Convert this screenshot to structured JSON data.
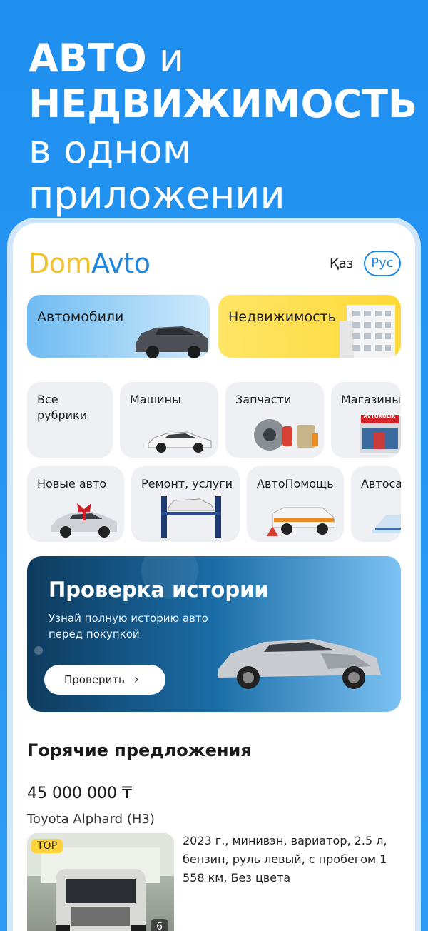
{
  "hero": {
    "line1_bold": "АВТО",
    "line1_rest": "и",
    "line2": "НЕДВИЖИМОСТЬ",
    "line3": "в одном",
    "line4": "приложении"
  },
  "app": {
    "logo_dom": "Dom",
    "logo_avto": "Avto",
    "lang_kaz": "Қаз",
    "lang_rus": "Рус"
  },
  "categories_big": [
    {
      "label": "Автомобили",
      "icon": "suv-car-icon"
    },
    {
      "label": "Недвижимость",
      "icon": "building-icon"
    }
  ],
  "rubrics_row1": [
    {
      "label": "Все рубрики"
    },
    {
      "label": "Машины"
    },
    {
      "label": "Запчасти"
    },
    {
      "label": "Магазины"
    }
  ],
  "rubrics_row2": [
    {
      "label": "Новые авто"
    },
    {
      "label": "Ремонт, услуги"
    },
    {
      "label": "АвтоПомощь"
    },
    {
      "label": "Автоса"
    }
  ],
  "shop_sign": "AVTOKOLIK",
  "banner": {
    "title": "Проверка истории",
    "subtitle": "Узнай полную историю авто перед покупкой",
    "button": "Проверить"
  },
  "hot": {
    "title": "Горячие предложения",
    "price": "45 000 000 ₸",
    "model": "Toyota Alphard (H3)",
    "badge": "TOP",
    "photo_count": "6",
    "description": "2023 г., минивэн, вариатор, 2.5 л, бензин, руль левый, с пробегом 1 558 км, Без цвета"
  },
  "colors": {
    "accent": "#1f86e0",
    "logo_yellow": "#f2c12e",
    "badge_yellow": "#ffd23a",
    "background": "#1f8ff0"
  }
}
